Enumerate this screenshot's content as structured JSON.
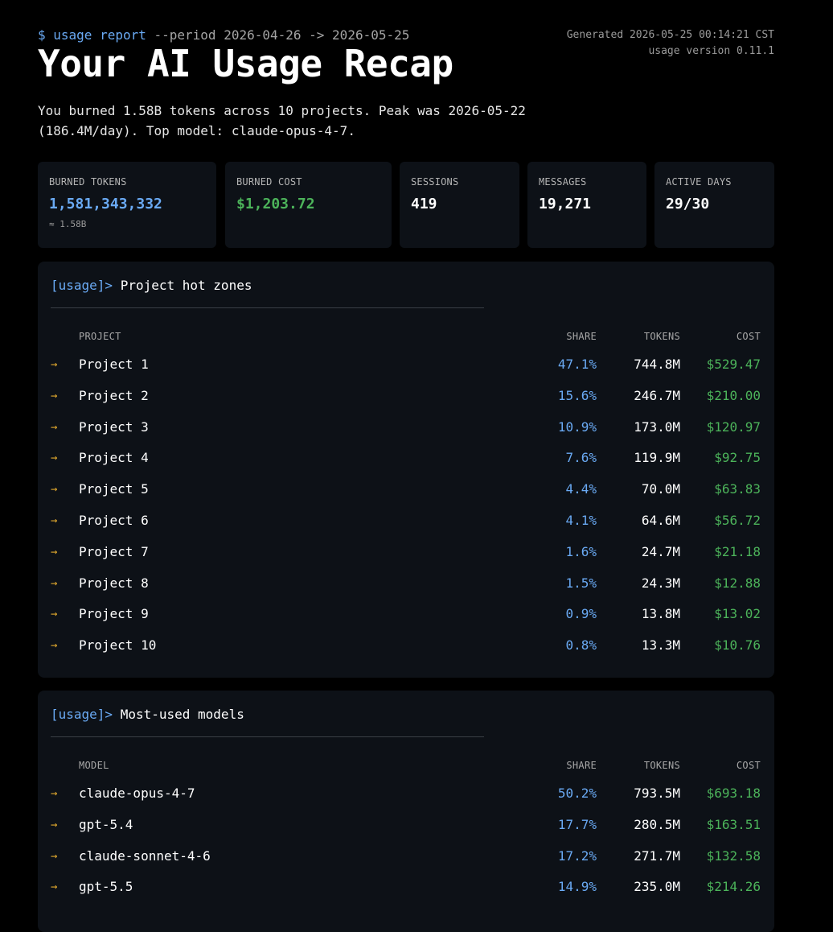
{
  "header": {
    "command_prompt": "$ usage report",
    "command_args": " --period 2026-04-26 -> 2026-05-25",
    "generated": "Generated 2026-05-25 00:14:21 CST",
    "version": "usage version 0.11.1",
    "title": "Your AI Usage Recap",
    "summary": "You burned 1.58B tokens across 10 projects. Peak was 2026-05-22 (186.4M/day). Top model: claude-opus-4-7."
  },
  "stats": {
    "burned_tokens": {
      "label": "BURNED TOKENS",
      "value": "1,581,343,332",
      "sub": "≈ 1.58B"
    },
    "burned_cost": {
      "label": "BURNED COST",
      "value": "$1,203.72"
    },
    "sessions": {
      "label": "SESSIONS",
      "value": "419"
    },
    "messages": {
      "label": "MESSAGES",
      "value": "19,271"
    },
    "active_days": {
      "label": "ACTIVE DAYS",
      "value": "29/30"
    }
  },
  "projects": {
    "tag": "[usage]>",
    "title": "Project hot zones",
    "columns": {
      "name": "PROJECT",
      "share": "SHARE",
      "tokens": "TOKENS",
      "cost": "COST"
    },
    "arrow": "→",
    "rows": [
      {
        "name": "Project 1",
        "share": "47.1%",
        "tokens": "744.8M",
        "cost": "$529.47"
      },
      {
        "name": "Project 2",
        "share": "15.6%",
        "tokens": "246.7M",
        "cost": "$210.00"
      },
      {
        "name": "Project 3",
        "share": "10.9%",
        "tokens": "173.0M",
        "cost": "$120.97"
      },
      {
        "name": "Project 4",
        "share": "7.6%",
        "tokens": "119.9M",
        "cost": "$92.75"
      },
      {
        "name": "Project 5",
        "share": "4.4%",
        "tokens": "70.0M",
        "cost": "$63.83"
      },
      {
        "name": "Project 6",
        "share": "4.1%",
        "tokens": "64.6M",
        "cost": "$56.72"
      },
      {
        "name": "Project 7",
        "share": "1.6%",
        "tokens": "24.7M",
        "cost": "$21.18"
      },
      {
        "name": "Project 8",
        "share": "1.5%",
        "tokens": "24.3M",
        "cost": "$12.88"
      },
      {
        "name": "Project 9",
        "share": "0.9%",
        "tokens": "13.8M",
        "cost": "$13.02"
      },
      {
        "name": "Project 10",
        "share": "0.8%",
        "tokens": "13.3M",
        "cost": "$10.76"
      }
    ]
  },
  "models": {
    "tag": "[usage]>",
    "title": "Most-used models",
    "columns": {
      "name": "MODEL",
      "share": "SHARE",
      "tokens": "TOKENS",
      "cost": "COST"
    },
    "arrow": "→",
    "rows": [
      {
        "name": "claude-opus-4-7",
        "share": "50.2%",
        "tokens": "793.5M",
        "cost": "$693.18"
      },
      {
        "name": "gpt-5.4",
        "share": "17.7%",
        "tokens": "280.5M",
        "cost": "$163.51"
      },
      {
        "name": "claude-sonnet-4-6",
        "share": "17.2%",
        "tokens": "271.7M",
        "cost": "$132.58"
      },
      {
        "name": "gpt-5.5",
        "share": "14.9%",
        "tokens": "235.0M",
        "cost": "$214.26"
      }
    ]
  }
}
